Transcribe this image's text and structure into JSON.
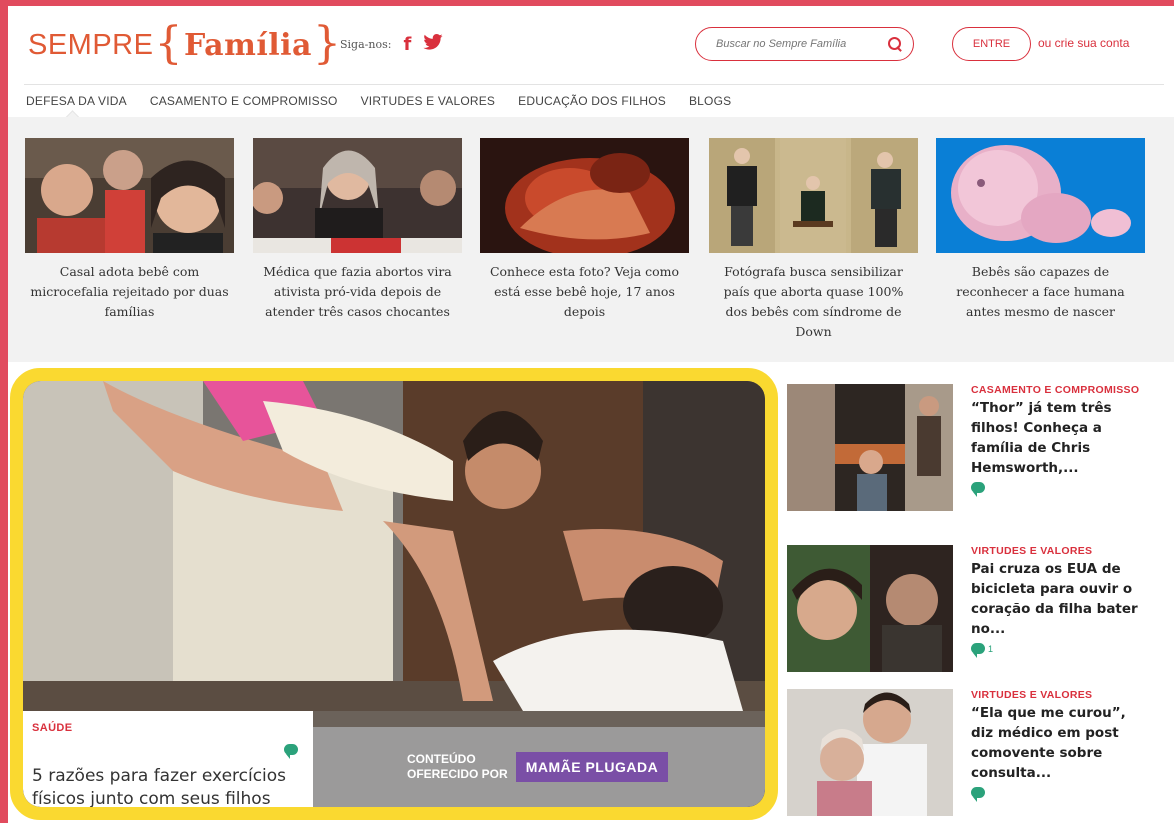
{
  "header": {
    "logo": {
      "sempre": "SEMPRE",
      "familia": "Família"
    },
    "follow_label": "Siga-nos:",
    "social": [
      {
        "name": "facebook-icon",
        "glyph": "f"
      },
      {
        "name": "twitter-icon",
        "glyph": "t"
      }
    ],
    "search": {
      "placeholder": "Buscar no Sempre Família"
    },
    "login_label": "ENTRE",
    "signup_label": "ou crie sua conta"
  },
  "nav": {
    "items": [
      {
        "label": "DEFESA DA VIDA"
      },
      {
        "label": "CASAMENTO E COMPROMISSO"
      },
      {
        "label": "VIRTUDES E VALORES"
      },
      {
        "label": "EDUCAÇÃO DOS FILHOS"
      },
      {
        "label": "BLOGS"
      }
    ]
  },
  "strip": {
    "cards": [
      {
        "title": "Casal adota bebê com microcefalia rejeitado por duas famílias"
      },
      {
        "title": "Médica que fazia abortos vira ativista pró-vida depois de atender três casos chocantes"
      },
      {
        "title": "Conhece esta foto? Veja como está esse bebê hoje, 17 anos depois"
      },
      {
        "title": "Fotógrafa busca sensibilizar país que aborta quase 100% dos bebês com síndrome de Down"
      },
      {
        "title": "Bebês são capazes de reconhecer a face humana antes mesmo de nascer"
      }
    ]
  },
  "feature": {
    "category": "SAÚDE",
    "title": "5 razões para fazer exercícios físicos junto com seus filhos",
    "sponsor_line1": "CONTEÚDO",
    "sponsor_line2": "OFERECIDO POR",
    "sponsor_logo": "MAMÃE PLUGADA"
  },
  "side": {
    "items": [
      {
        "category": "CASAMENTO E COMPROMISSO",
        "title": "“Thor” já tem três filhos! Conheça a família de Chris Hemsworth,...",
        "comments": ""
      },
      {
        "category": "VIRTUDES E VALORES",
        "title": "Pai cruza os EUA de bicicleta para ouvir o coração da filha bater no...",
        "comments": "1"
      },
      {
        "category": "VIRTUDES E VALORES",
        "title": "“Ela que me curou”, diz médico em post comovente sobre consulta...",
        "comments": ""
      }
    ]
  },
  "colors": {
    "accent": "#d9303d",
    "logo": "#e05a35",
    "frame": "#fad930",
    "comment": "#2ba27b",
    "border": "#e14b5e"
  }
}
